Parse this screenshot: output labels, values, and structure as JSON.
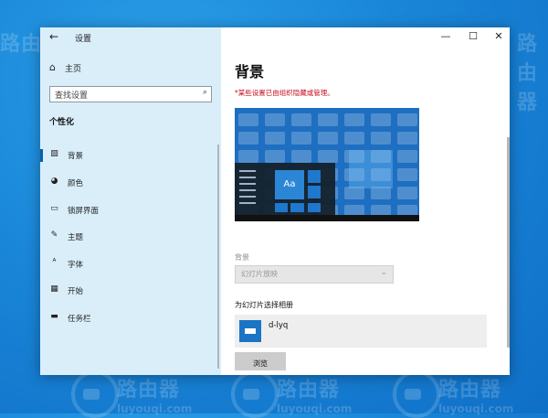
{
  "desktop": {
    "watermark_cn": "路由器",
    "watermark_en": "luyouqi.com"
  },
  "window": {
    "title": "设置",
    "controls": {
      "minimize": "—",
      "maximize": "☐",
      "close": "✕"
    }
  },
  "sidebar": {
    "back_icon": "back-arrow-icon",
    "home_label": "主页",
    "search_placeholder": "查找设置",
    "section_title": "个性化",
    "items": [
      {
        "label": "背景",
        "icon": "image-icon",
        "selected": true
      },
      {
        "label": "颜色",
        "icon": "palette-icon",
        "selected": false
      },
      {
        "label": "锁屏界面",
        "icon": "lock-screen-icon",
        "selected": false
      },
      {
        "label": "主题",
        "icon": "brush-icon",
        "selected": false
      },
      {
        "label": "字体",
        "icon": "font-icon",
        "selected": false
      },
      {
        "label": "开始",
        "icon": "start-icon",
        "selected": false
      },
      {
        "label": "任务栏",
        "icon": "taskbar-icon",
        "selected": false
      }
    ]
  },
  "main": {
    "page_title": "背景",
    "warning": "*某些设置已由组织隐藏或管理。",
    "preview_tile_label": "Aa",
    "background_label": "背景",
    "background_value": "幻灯片放映",
    "album_label": "为幻灯片选择相册",
    "album_name": "d-lyq",
    "browse_label": "浏览"
  },
  "colors": {
    "accent": "#0063b1",
    "warning": "#c50f1f",
    "sidebar_bg": "#daeefa"
  }
}
